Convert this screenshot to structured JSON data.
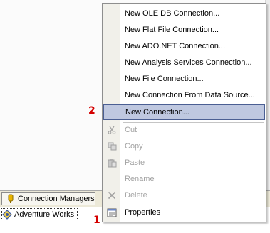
{
  "context_menu": {
    "items": [
      {
        "label": "New OLE DB Connection...",
        "enabled": true
      },
      {
        "label": "New Flat File Connection...",
        "enabled": true
      },
      {
        "label": "New ADO.NET Connection...",
        "enabled": true
      },
      {
        "label": "New Analysis Services Connection...",
        "enabled": true
      },
      {
        "label": "New File Connection...",
        "enabled": true
      },
      {
        "label": "New Connection From Data Source...",
        "enabled": true
      },
      {
        "label": "New Connection...",
        "enabled": true,
        "highlighted": true
      },
      {
        "label": "Cut",
        "enabled": false,
        "icon": "scissors-icon"
      },
      {
        "label": "Copy",
        "enabled": false,
        "icon": "copy-icon"
      },
      {
        "label": "Paste",
        "enabled": false,
        "icon": "paste-icon"
      },
      {
        "label": "Rename",
        "enabled": false
      },
      {
        "label": "Delete",
        "enabled": false,
        "icon": "delete-x-icon"
      },
      {
        "label": "Properties",
        "enabled": true,
        "icon": "properties-icon"
      }
    ]
  },
  "connection_managers_tab": {
    "label": "Connection Managers"
  },
  "connection_manager_item": {
    "label": "Adventure Works"
  },
  "callouts": {
    "one": "1",
    "two": "2"
  },
  "colors": {
    "highlight_bg": "#bfc8e0",
    "highlight_border": "#4b5f93",
    "callout": "#d40000"
  }
}
